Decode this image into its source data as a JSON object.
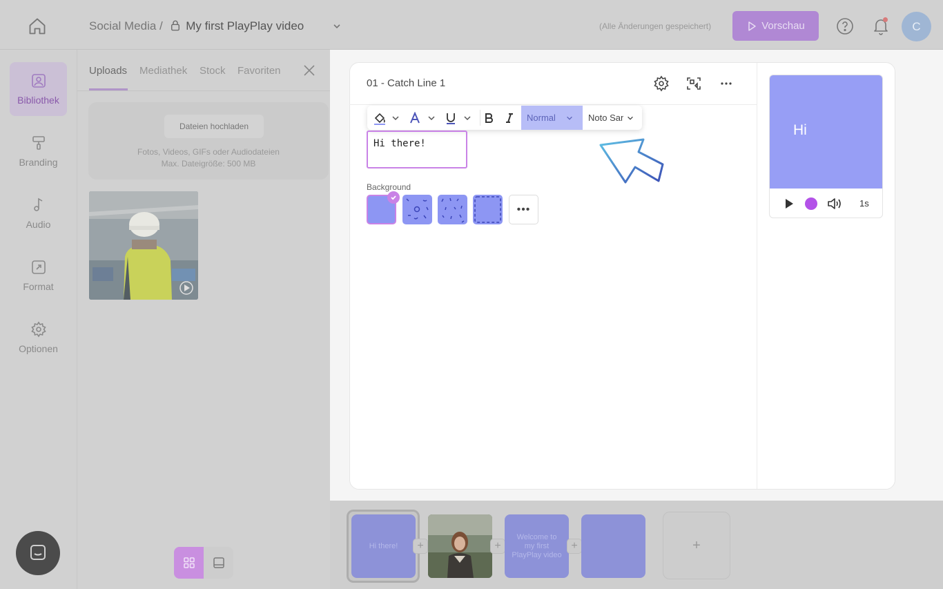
{
  "header": {
    "breadcrumb_folder": "Social Media /",
    "project_name": "My first PlayPlay video",
    "save_status": "(Alle Änderungen gespeichert)",
    "preview_label": "Vorschau",
    "avatar_initial": "C"
  },
  "rail": {
    "items": [
      {
        "label": "Bibliothek",
        "icon": "image-icon",
        "active": true
      },
      {
        "label": "Branding",
        "icon": "paint-roller-icon"
      },
      {
        "label": "Audio",
        "icon": "music-note-icon"
      },
      {
        "label": "Format",
        "icon": "resize-icon"
      },
      {
        "label": "Optionen",
        "icon": "gear-icon"
      }
    ]
  },
  "library": {
    "tabs": [
      "Uploads",
      "Mediathek",
      "Stock",
      "Favoriten"
    ],
    "active_tab": "Uploads",
    "upload_button": "Dateien hochladen",
    "upload_hint_1": "Fotos, Videos, GIFs oder Audiodateien",
    "upload_hint_2": "Max. Dateigröße: 500 MB"
  },
  "editor": {
    "scene_title": "01 - Catch Line 1",
    "text_style": "Normal",
    "font_name": "Noto Sans",
    "text_value": "Hi there!",
    "background_label": "Background",
    "more_label": "•••"
  },
  "preview": {
    "text": "Hi",
    "duration": "1s"
  },
  "timeline": {
    "scenes": [
      {
        "label": "Hi there!"
      },
      {
        "label": ""
      },
      {
        "label": "Welcome to my first PlayPlay video"
      },
      {
        "label": ""
      }
    ],
    "add_label": "+"
  },
  "colors": {
    "accent": "#c982e6",
    "scene_blue": "#8d96f3",
    "preview_button": "#b088d4"
  }
}
